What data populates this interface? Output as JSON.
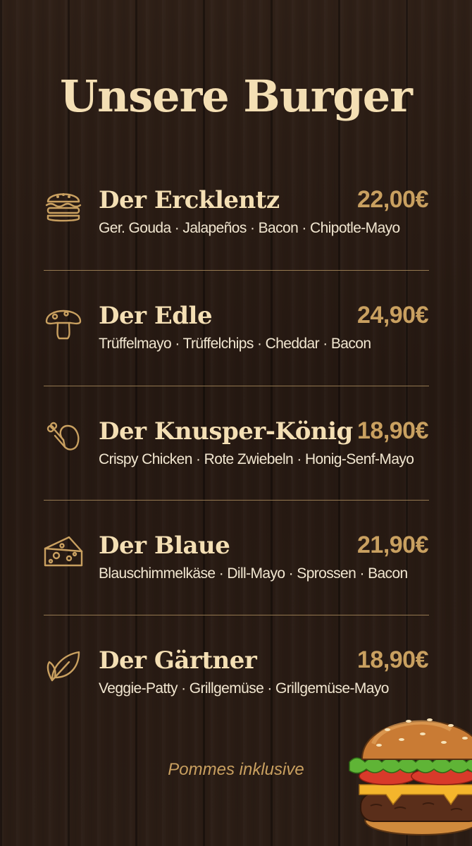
{
  "title": "Unsere Burger",
  "items": [
    {
      "name": "Der Ercklentz",
      "price": "22,00€",
      "desc": "Ger. Gouda · Jalapeños · Bacon · Chipotle-Mayo",
      "icon": "burger-icon"
    },
    {
      "name": "Der Edle",
      "price": "24,90€",
      "desc": "Trüffelmayo · Trüffelchips · Cheddar · Bacon",
      "icon": "mushroom-icon"
    },
    {
      "name": "Der Knusper-König",
      "price": "18,90€",
      "desc": "Crispy Chicken · Rote Zwiebeln · Honig-Senf-Mayo",
      "icon": "chicken-leg-icon"
    },
    {
      "name": "Der Blaue",
      "price": "21,90€",
      "desc": "Blauschimmelkäse · Dill-Mayo · Sprossen · Bacon",
      "icon": "cheese-icon"
    },
    {
      "name": "Der Gärtner",
      "price": "18,90€",
      "desc": "Veggie-Patty · Grillgemüse · Grillgemüse-Mayo",
      "icon": "leaf-icon"
    }
  ],
  "footnote": "Pommes inklusive",
  "colors": {
    "title": "#f4dfb4",
    "price": "#c9a060",
    "description": "#f1e6d0",
    "divider": "#a88a5c"
  }
}
